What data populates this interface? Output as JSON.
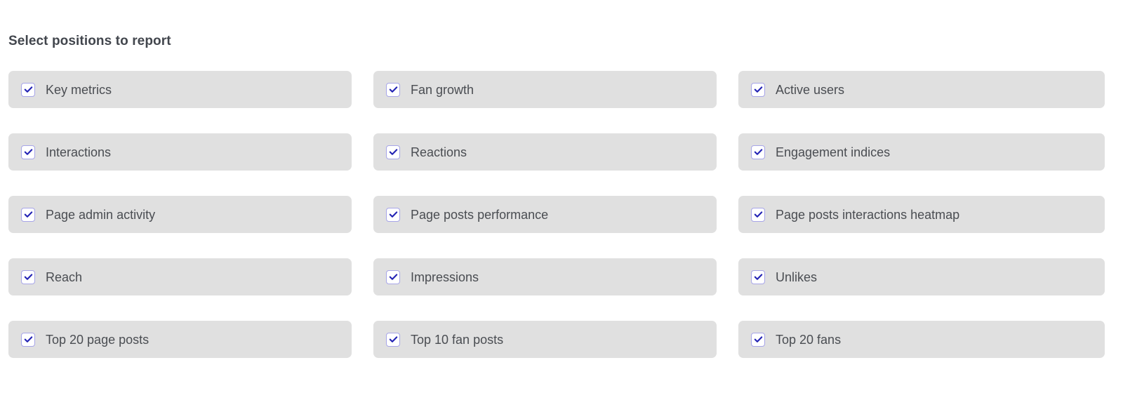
{
  "heading": "Select positions to report",
  "colors": {
    "card_background": "#e0e0e0",
    "page_background": "#ffffff",
    "heading_text": "#42464d",
    "label_text": "#4a4d52",
    "checkbox_border": "#a7a5e8",
    "checkbox_check": "#2323b4",
    "checkbox_fill": "#ffffff"
  },
  "options": [
    {
      "label": "Key metrics",
      "checked": true,
      "column": 1,
      "row": 1
    },
    {
      "label": "Fan growth",
      "checked": true,
      "column": 2,
      "row": 1
    },
    {
      "label": "Active users",
      "checked": true,
      "column": 3,
      "row": 1
    },
    {
      "label": "Interactions",
      "checked": true,
      "column": 1,
      "row": 2
    },
    {
      "label": "Reactions",
      "checked": true,
      "column": 2,
      "row": 2
    },
    {
      "label": "Engagement indices",
      "checked": true,
      "column": 3,
      "row": 2
    },
    {
      "label": "Page admin activity",
      "checked": true,
      "column": 1,
      "row": 3
    },
    {
      "label": "Page posts performance",
      "checked": true,
      "column": 2,
      "row": 3
    },
    {
      "label": "Page posts interactions heatmap",
      "checked": true,
      "column": 3,
      "row": 3
    },
    {
      "label": "Reach",
      "checked": true,
      "column": 1,
      "row": 4
    },
    {
      "label": "Impressions",
      "checked": true,
      "column": 2,
      "row": 4
    },
    {
      "label": "Unlikes",
      "checked": true,
      "column": 3,
      "row": 4
    },
    {
      "label": "Top 20 page posts",
      "checked": true,
      "column": 1,
      "row": 5
    },
    {
      "label": "Top 10 fan posts",
      "checked": true,
      "column": 2,
      "row": 5
    },
    {
      "label": "Top 20 fans",
      "checked": true,
      "column": 3,
      "row": 5
    }
  ]
}
